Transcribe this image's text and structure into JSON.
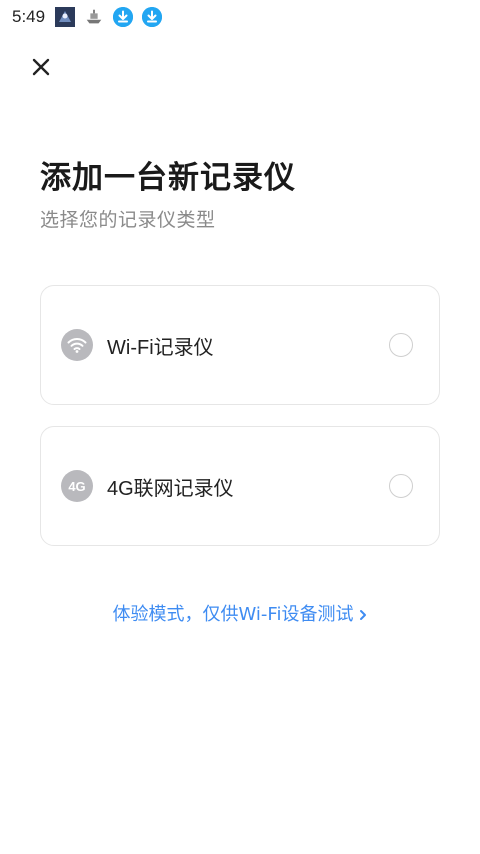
{
  "status_bar": {
    "time": "5:49",
    "icons": [
      "app-game-icon",
      "app-ship-icon",
      "download-icon",
      "download-icon"
    ]
  },
  "header": {
    "close_icon": "close-icon"
  },
  "main": {
    "title": "添加一台新记录仪",
    "subtitle": "选择您的记录仪类型",
    "options": [
      {
        "label": "Wi-Fi记录仪",
        "icon": "wifi-icon",
        "selected": false
      },
      {
        "label": "4G联网记录仪",
        "icon": "4g-icon",
        "icon_text": "4G",
        "selected": false
      }
    ],
    "demo_link": "体验模式，仅供Wi-Fi设备测试"
  },
  "colors": {
    "accent": "#3f8cf2",
    "icon_gray": "#b9b9bd",
    "download_blue": "#22a6f2"
  }
}
